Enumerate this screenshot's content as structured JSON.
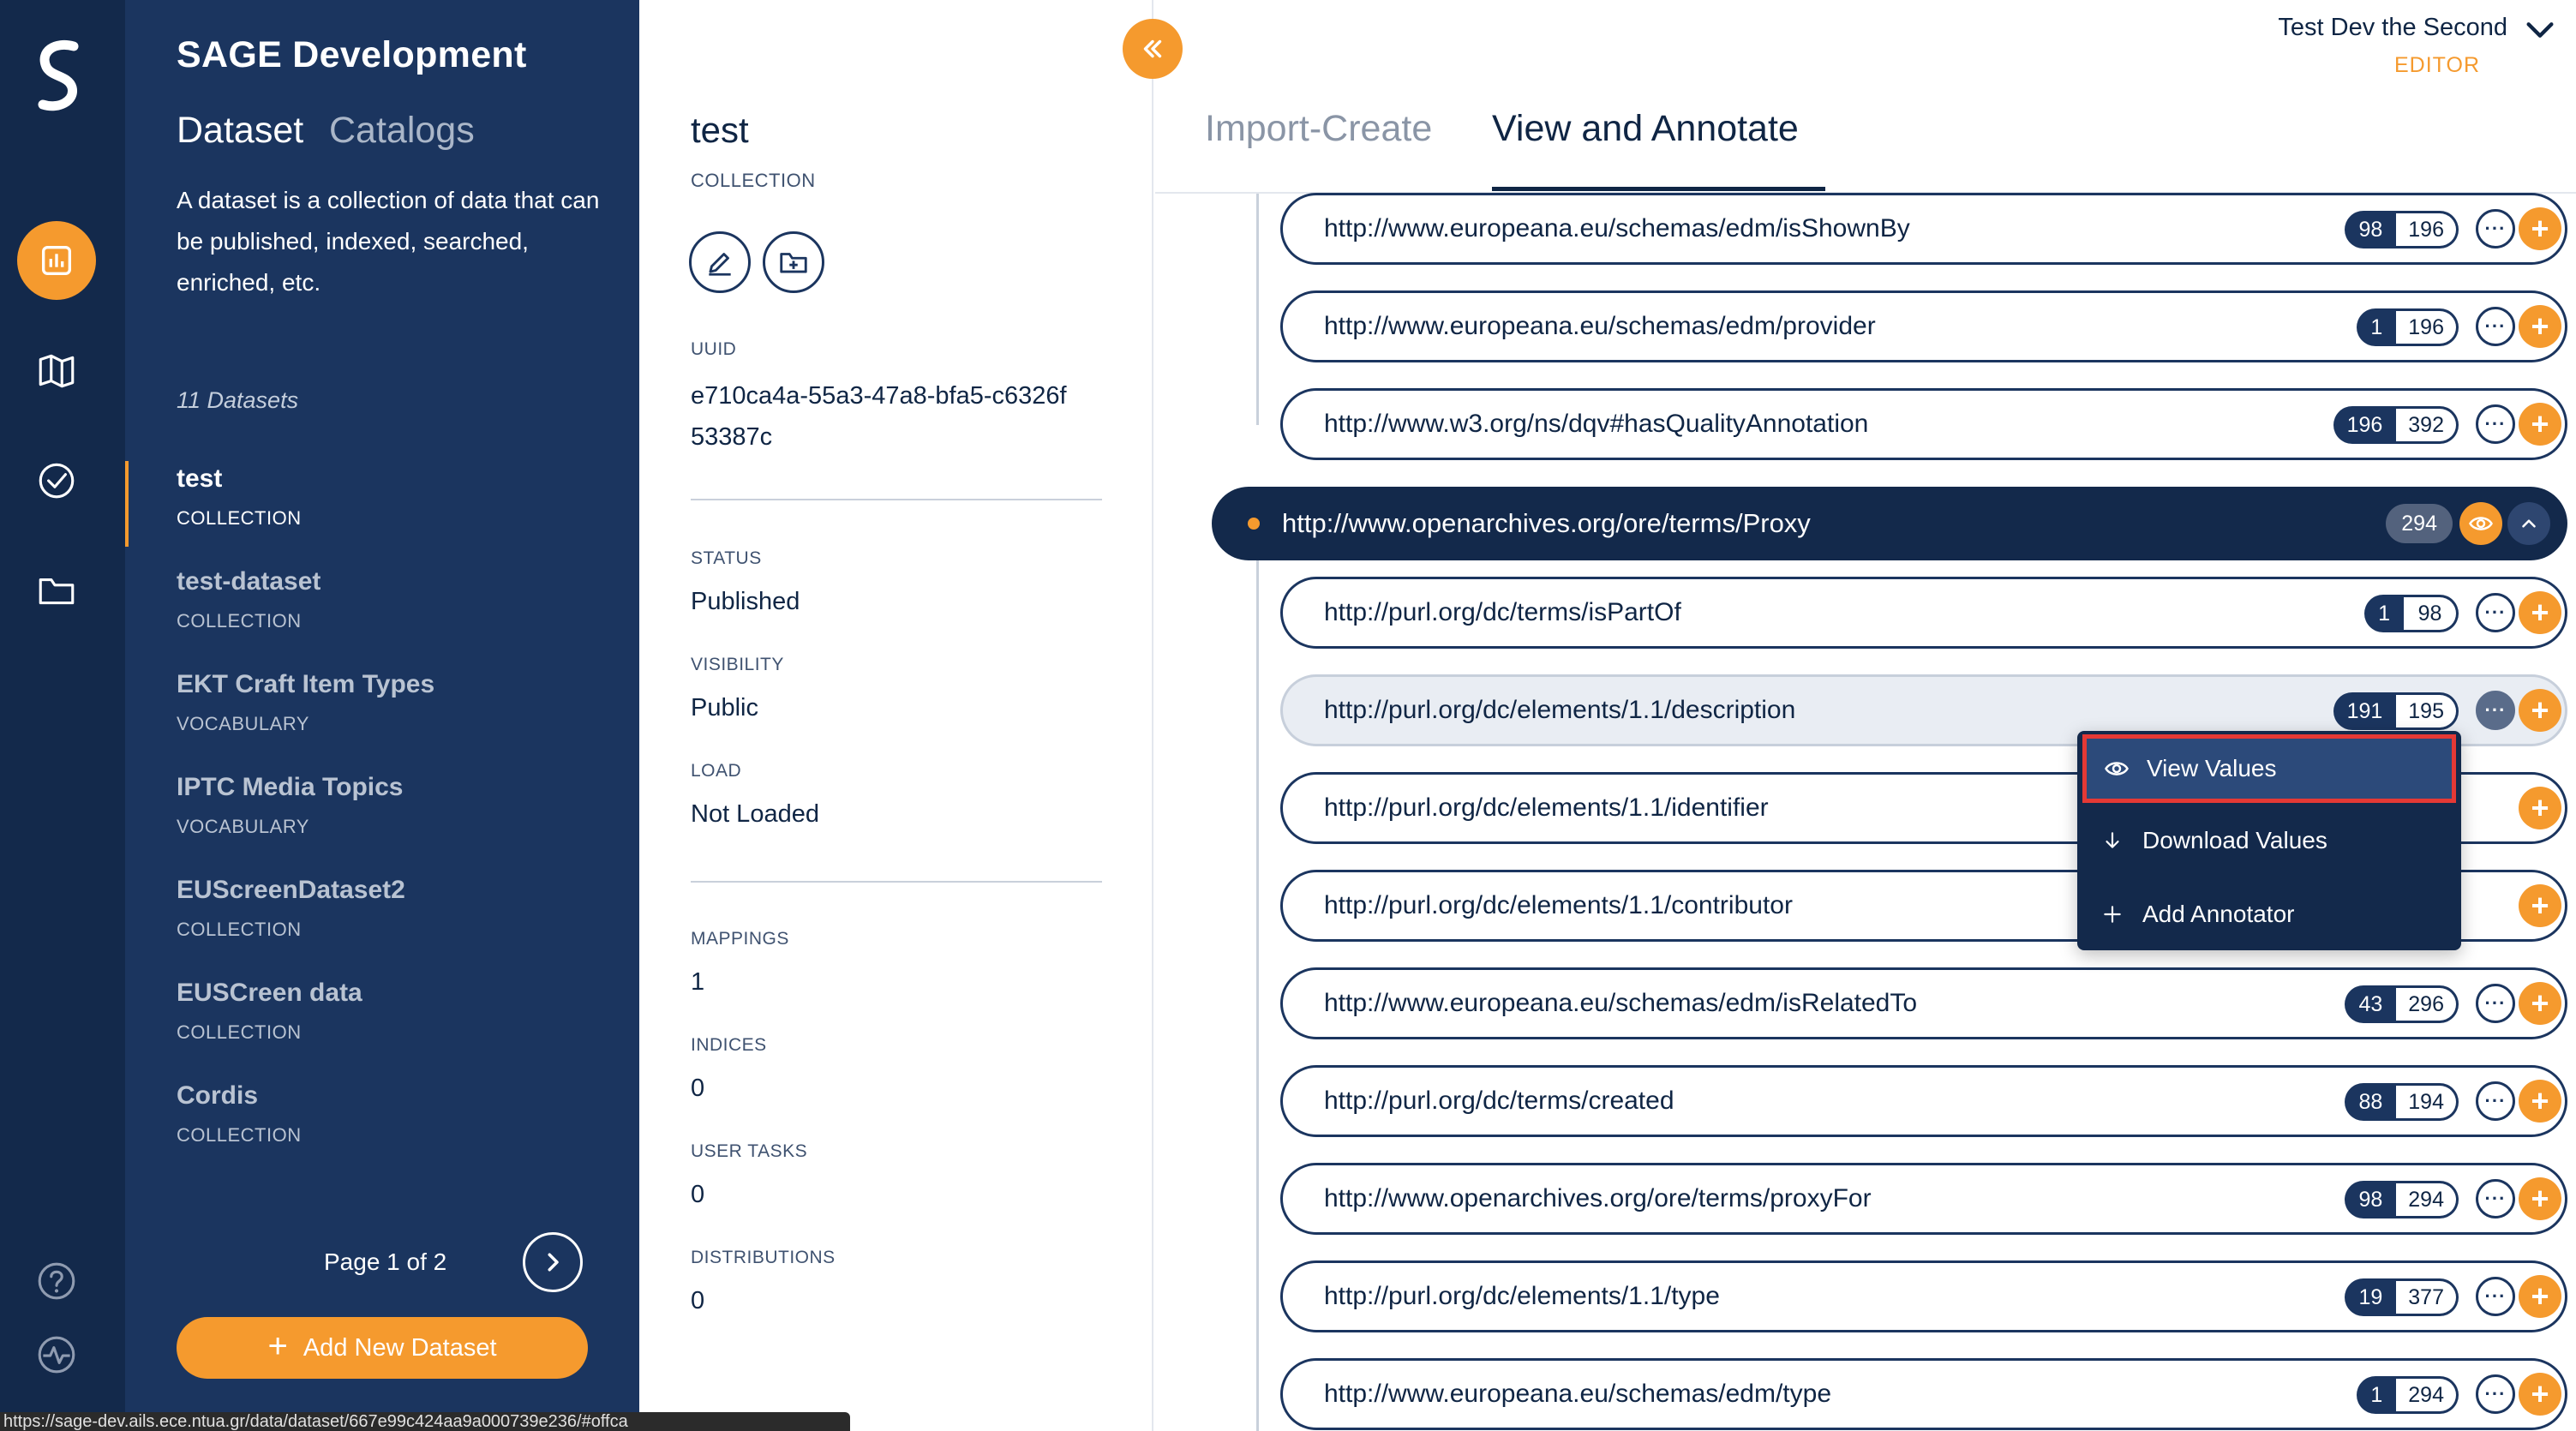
{
  "rail": {
    "icons": [
      "logo-icon",
      "dashboard-icon",
      "map-icon",
      "check-circle-icon",
      "folder-icon",
      "help-icon",
      "activity-icon"
    ],
    "accent": "#f59a2e"
  },
  "sidebar": {
    "title": "SAGE Development",
    "tabs": [
      {
        "label": "Dataset"
      },
      {
        "label": "Catalogs"
      }
    ],
    "description": "A dataset is a collection of data that can be published, indexed, searched, enriched, etc.",
    "count": "11 Datasets",
    "datasets": [
      {
        "name": "test",
        "type": "COLLECTION"
      },
      {
        "name": "test-dataset",
        "type": "COLLECTION"
      },
      {
        "name": "EKT Craft Item Types",
        "type": "VOCABULARY"
      },
      {
        "name": "IPTC Media Topics",
        "type": "VOCABULARY"
      },
      {
        "name": "EUScreenDataset2",
        "type": "COLLECTION"
      },
      {
        "name": "EUSCreen data",
        "type": "COLLECTION"
      },
      {
        "name": "Cordis",
        "type": "COLLECTION"
      }
    ],
    "page": "Page 1 of 2",
    "add_label": "Add New Dataset"
  },
  "details": {
    "name": "test",
    "type": "COLLECTION",
    "uuid_label": "UUID",
    "uuid": "e710ca4a-55a3-47a8-bfa5-c6326f53387c",
    "status_label": "STATUS",
    "status": "Published",
    "visibility_label": "VISIBILITY",
    "visibility": "Public",
    "load_label": "LOAD",
    "load": "Not Loaded",
    "mappings_label": "MAPPINGS",
    "mappings": "1",
    "indices_label": "INDICES",
    "indices": "0",
    "user_tasks_label": "USER TASKS",
    "user_tasks": "0",
    "distributions_label": "DISTRIBUTIONS",
    "distributions": "0"
  },
  "header": {
    "user_name": "Test Dev the Second",
    "user_role": "EDITOR",
    "tabs": [
      {
        "label": "Import-Create"
      },
      {
        "label": "View and Annotate"
      }
    ],
    "active_tab": "View and Annotate"
  },
  "tree": {
    "rows_before": [
      {
        "uri": "http://www.europeana.eu/schemas/edm/isShownBy",
        "a": "98",
        "b": "196"
      },
      {
        "uri": "http://www.europeana.eu/schemas/edm/provider",
        "a": "1",
        "b": "196"
      },
      {
        "uri": "http://www.w3.org/ns/dqv#hasQualityAnnotation",
        "a": "196",
        "b": "392"
      }
    ],
    "class": {
      "uri": "http://www.openarchives.org/ore/terms/Proxy",
      "count": "294"
    },
    "rows_after": [
      {
        "uri": "http://purl.org/dc/terms/isPartOf",
        "a": "1",
        "b": "98"
      },
      {
        "uri": "http://purl.org/dc/elements/1.1/description",
        "a": "191",
        "b": "195"
      },
      {
        "uri": "http://purl.org/dc/elements/1.1/identifier",
        "a": "",
        "b": ""
      },
      {
        "uri": "http://purl.org/dc/elements/1.1/contributor",
        "a": "",
        "b": ""
      },
      {
        "uri": "http://www.europeana.eu/schemas/edm/isRelatedTo",
        "a": "43",
        "b": "296"
      },
      {
        "uri": "http://purl.org/dc/terms/created",
        "a": "88",
        "b": "194"
      },
      {
        "uri": "http://www.openarchives.org/ore/terms/proxyFor",
        "a": "98",
        "b": "294"
      },
      {
        "uri": "http://purl.org/dc/elements/1.1/type",
        "a": "19",
        "b": "377"
      },
      {
        "uri": "http://www.europeana.eu/schemas/edm/type",
        "a": "1",
        "b": "294"
      }
    ]
  },
  "menu": {
    "items": [
      {
        "label": "View Values",
        "icon": "eye-icon"
      },
      {
        "label": "Download Values",
        "icon": "arrow-down-icon"
      },
      {
        "label": "Add Annotator",
        "icon": "plus-icon"
      }
    ]
  },
  "statusbar": {
    "url": "https://sage-dev.ails.ece.ntua.gr/data/dataset/667e99c424aa9a000739e236/#offca"
  }
}
